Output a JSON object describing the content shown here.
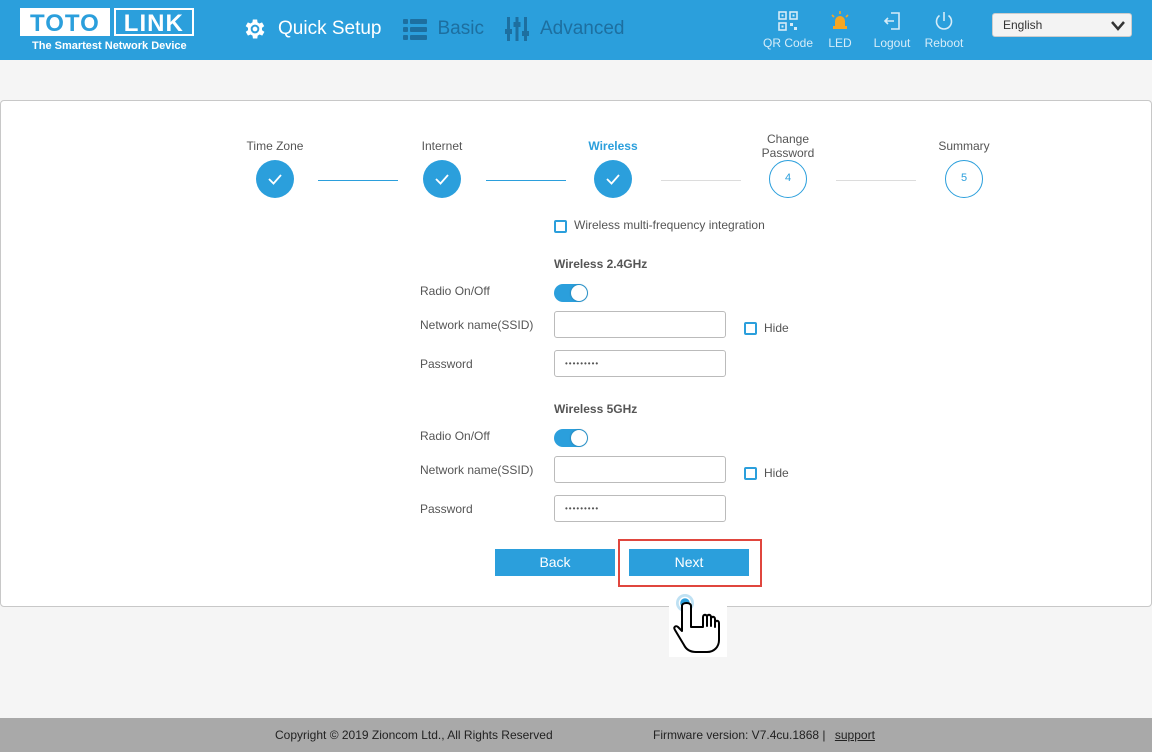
{
  "header": {
    "logo": {
      "part1": "TOTO",
      "part2": "LINK",
      "tagline": "The Smartest Network Device"
    },
    "nav": [
      {
        "label": "Quick Setup",
        "icon": "gear-icon"
      },
      {
        "label": "Basic",
        "icon": "list-icon"
      },
      {
        "label": "Advanced",
        "icon": "sliders-icon"
      }
    ],
    "tools": [
      {
        "label": "QR Code",
        "icon": "qr-code-icon"
      },
      {
        "label": "LED",
        "icon": "led-icon"
      },
      {
        "label": "Logout",
        "icon": "logout-icon"
      },
      {
        "label": "Reboot",
        "icon": "power-icon"
      }
    ],
    "language": "English"
  },
  "steps": [
    {
      "label": "Time Zone",
      "state": "done"
    },
    {
      "label": "Internet",
      "state": "done"
    },
    {
      "label": "Wireless",
      "state": "active"
    },
    {
      "label_line1": "Change",
      "label_line2": "Password",
      "number": "4",
      "state": "todo"
    },
    {
      "label": "Summary",
      "number": "5",
      "state": "todo"
    }
  ],
  "form": {
    "multi_freq_label": "Wireless multi-frequency integration",
    "band24": {
      "title": "Wireless 2.4GHz",
      "radio_label": "Radio On/Off",
      "ssid_label": "Network name(SSID)",
      "ssid_value": "",
      "hide_label": "Hide",
      "password_label": "Password",
      "password_value": "•••••••••"
    },
    "band5": {
      "title": "Wireless 5GHz",
      "radio_label": "Radio On/Off",
      "ssid_label": "Network name(SSID)",
      "ssid_value": "",
      "hide_label": "Hide",
      "password_label": "Password",
      "password_value": "•••••••••"
    },
    "back_label": "Back",
    "next_label": "Next"
  },
  "footer": {
    "copyright": "Copyright © 2019 Zioncom Ltd., All Rights Reserved",
    "firmware": "Firmware version: V7.4cu.1868  |",
    "support": "support"
  },
  "colors": {
    "primary": "#2b9fdc",
    "highlight": "#e0463e",
    "led": "#f5a623",
    "footer": "#a9a9a9"
  }
}
